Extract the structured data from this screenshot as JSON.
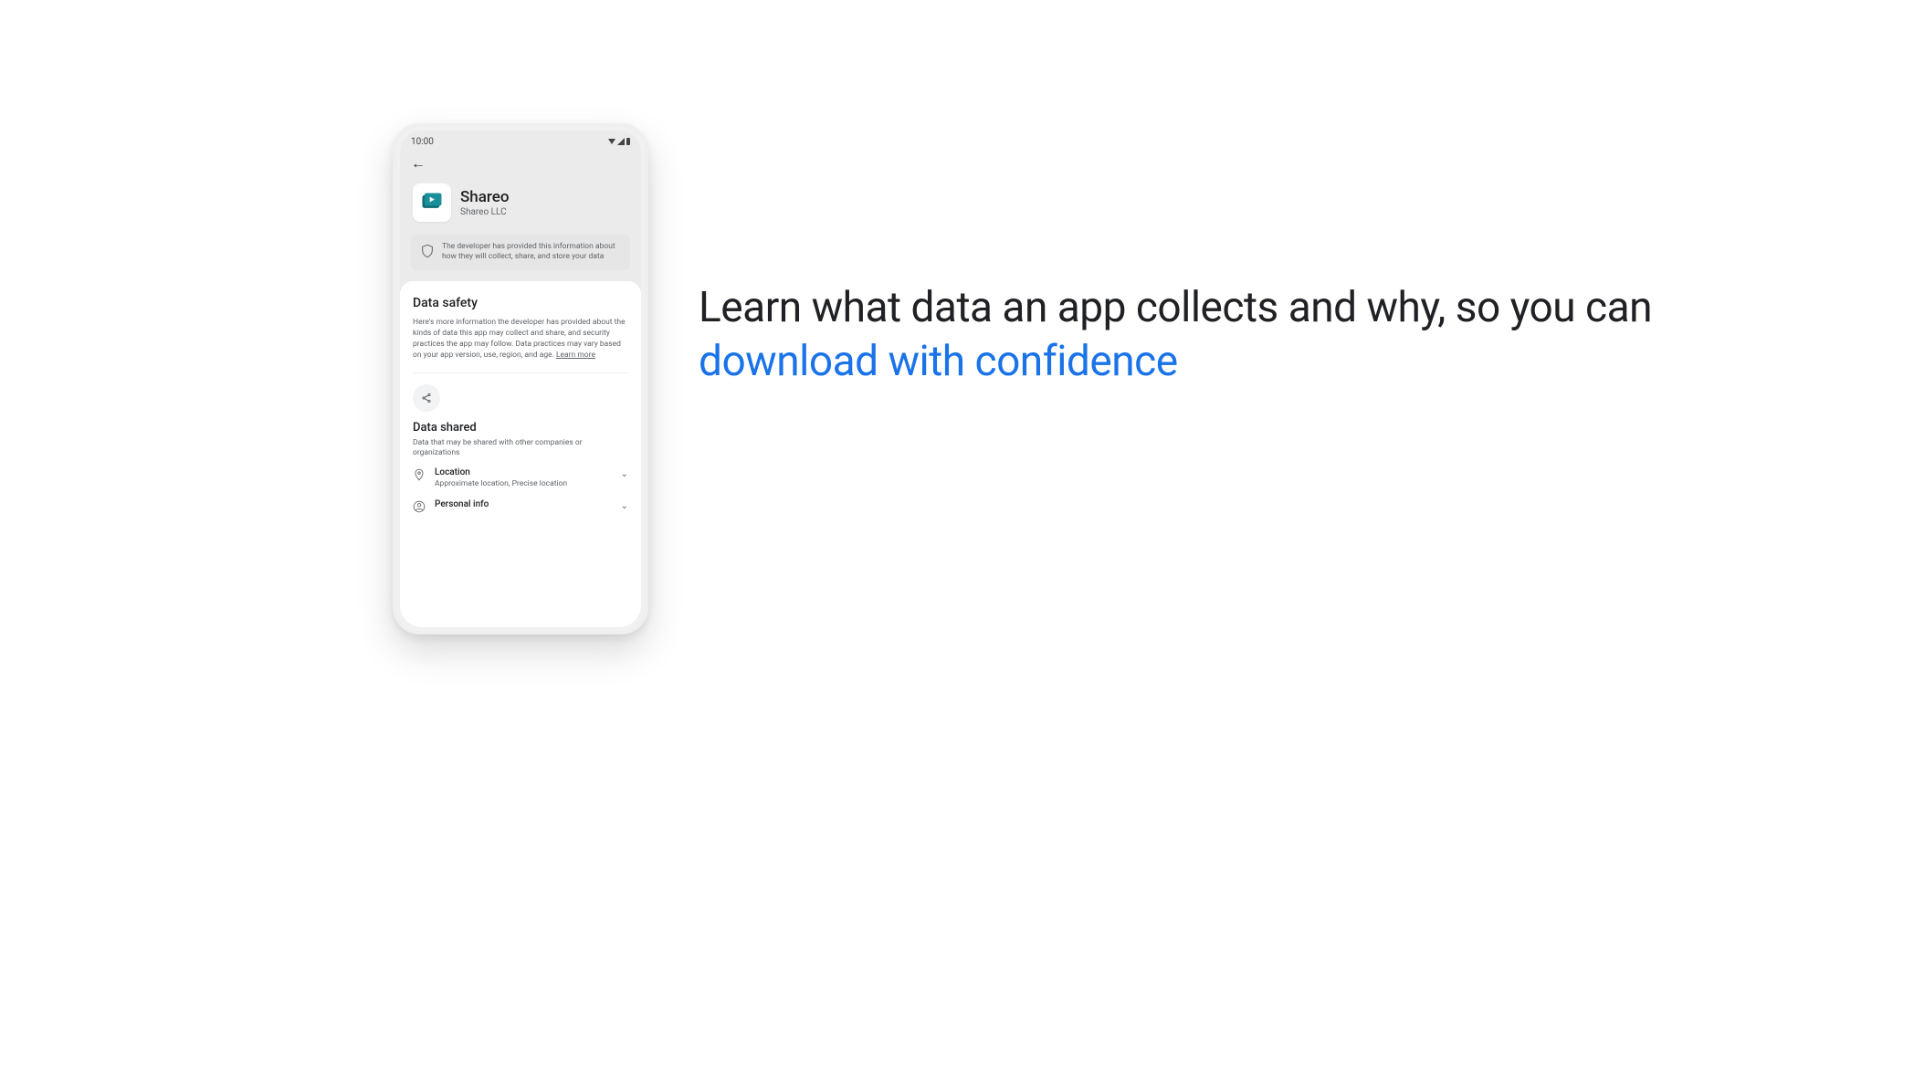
{
  "statusbar": {
    "time": "10:00"
  },
  "nav": {
    "back_icon": "←"
  },
  "app": {
    "name": "Shareo",
    "publisher": "Shareo LLC"
  },
  "info_banner": {
    "text": "The developer has provided this information about how they will collect, share, and store your data"
  },
  "data_safety": {
    "heading": "Data safety",
    "body": "Here's more information the developer has provided about the kinds of data this app may collect and share, and security practices the app may follow. Data practices may vary based on your app version, use, region, and age.",
    "learn_more": "Learn more"
  },
  "data_shared": {
    "heading": "Data shared",
    "subtitle": "Data that may be shared with other companies or organizations",
    "items": [
      {
        "label": "Location",
        "desc": "Approximate location, Precise location"
      },
      {
        "label": "Personal info",
        "desc": ""
      }
    ]
  },
  "headline": {
    "part1": "Learn what data an app collects and why, so you can ",
    "highlight": "download with confidence"
  }
}
